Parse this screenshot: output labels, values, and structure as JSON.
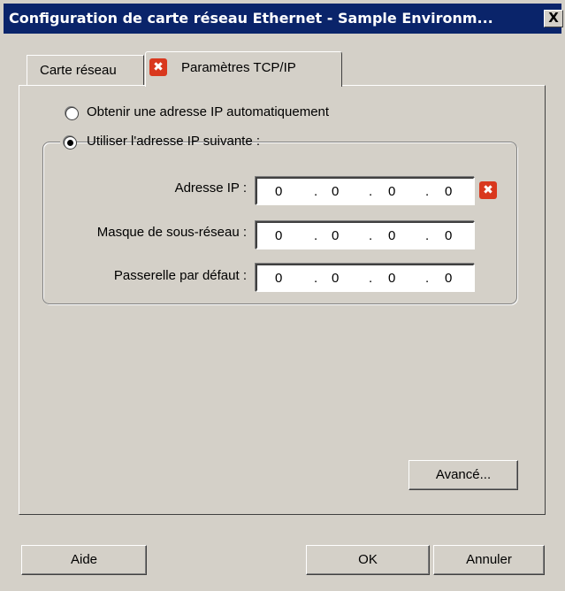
{
  "window": {
    "title": "Configuration de carte réseau Ethernet - Sample Environm...",
    "close_glyph": "X"
  },
  "tabs": [
    {
      "label": "Carte réseau"
    },
    {
      "label": "Paramètres TCP/IP",
      "error_glyph": "✖",
      "active": true
    }
  ],
  "options": {
    "auto_ip": "Obtenir une adresse IP automatiquement",
    "static_ip": "Utiliser l'adresse IP suivante :",
    "selected": "static_ip"
  },
  "fields": {
    "ip": {
      "label": "Adresse IP :",
      "octets": [
        "0",
        "0",
        "0",
        "0"
      ],
      "error_glyph": "✖"
    },
    "mask": {
      "label": "Masque de sous-réseau :",
      "octets": [
        "0",
        "0",
        "0",
        "0"
      ]
    },
    "gateway": {
      "label": "Passerelle par défaut :",
      "octets": [
        "0",
        "0",
        "0",
        "0"
      ]
    },
    "separator": "."
  },
  "buttons": {
    "advanced": "Avancé...",
    "help": "Aide",
    "ok": "OK",
    "cancel": "Annuler"
  },
  "colors": {
    "titlebar": "#0a246a",
    "face": "#d4d0c8",
    "error": "#d9381e"
  },
  "icons": {
    "tab_error": "error-icon",
    "ip_error": "error-icon",
    "close": "close-icon"
  }
}
